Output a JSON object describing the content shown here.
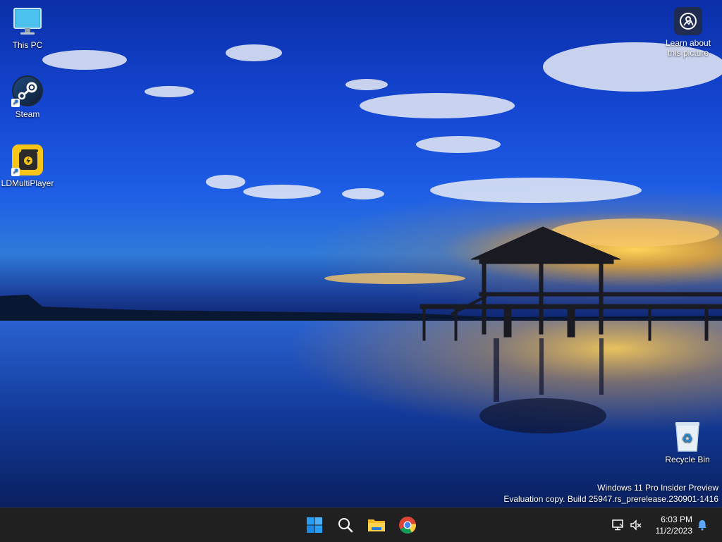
{
  "desktop": {
    "icons": [
      {
        "label": "This PC",
        "icon": "monitor-icon"
      },
      {
        "label": "Steam",
        "icon": "steam-icon"
      },
      {
        "label": "LDMultiPlayer",
        "icon": "ldmultiplayer-icon"
      },
      {
        "label": "Recycle Bin",
        "icon": "recycle-bin-icon"
      }
    ],
    "learn_about": {
      "line1": "Learn about",
      "line2": "this picture",
      "icon": "camera-pin-icon"
    },
    "watermark": {
      "line1": "Windows 11 Pro Insider Preview",
      "line2": "Evaluation copy. Build 25947.rs_prerelease.230901-1416"
    }
  },
  "taskbar": {
    "pinned": [
      {
        "name": "start",
        "icon": "windows-start-icon"
      },
      {
        "name": "search",
        "icon": "search-icon"
      },
      {
        "name": "file-explorer",
        "icon": "folder-icon"
      },
      {
        "name": "chrome",
        "icon": "chrome-icon"
      }
    ],
    "tray": {
      "time": "6:03 PM",
      "date": "11/2/2023",
      "icons": [
        "network-icon",
        "volume-muted-icon",
        "notification-bell-icon"
      ]
    }
  },
  "colors": {
    "taskbar_bg": "#202020",
    "accent": "#1a73e8",
    "start_blue": "#2a9df4"
  }
}
